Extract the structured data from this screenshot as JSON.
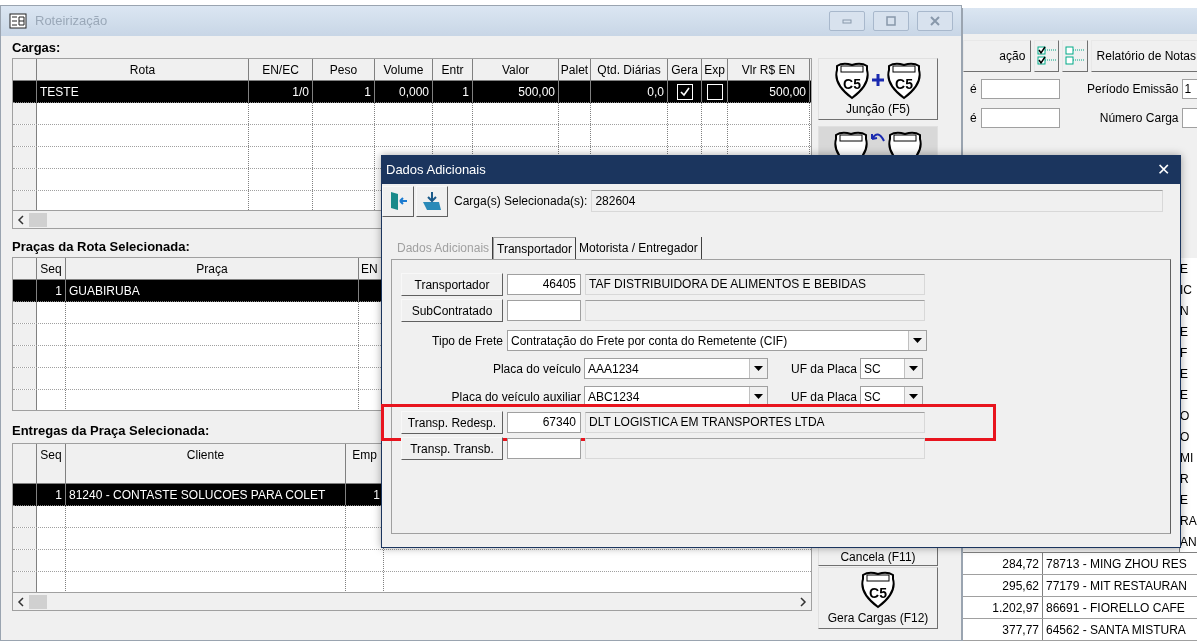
{
  "main_window": {
    "title": "Roteirização",
    "cargas": {
      "label": "Cargas:",
      "columns": [
        {
          "label": "Rota"
        },
        {
          "label": "EN/EC"
        },
        {
          "label": "Peso"
        },
        {
          "label": "Volume"
        },
        {
          "label": "Entr"
        },
        {
          "label": "Valor"
        },
        {
          "label": "Palet"
        },
        {
          "label": "Qtd. Diárias"
        },
        {
          "label": "Gera"
        },
        {
          "label": "Exp"
        },
        {
          "label": "Vlr R$ EN"
        }
      ],
      "rows": [
        {
          "selected": true,
          "cells": [
            "TESTE",
            "1/0",
            "1",
            "0,000",
            "1",
            "500,00",
            null,
            "0,0",
            {
              "kind": "checkbox",
              "checked": true
            },
            {
              "kind": "checkbox",
              "checked": false
            },
            "500,00"
          ]
        }
      ]
    },
    "pracas": {
      "label": "Praças da Rota Selecionada:",
      "columns": [
        {
          "label": "Seq"
        },
        {
          "label": "Praça"
        },
        {
          "label": "EN"
        }
      ],
      "rows": [
        {
          "selected": true,
          "cells": [
            "1",
            "GUABIRUBA",
            null
          ]
        }
      ]
    },
    "entregas": {
      "label": "Entregas da Praça Selecionada:",
      "columns": [
        {
          "label": "Seq"
        },
        {
          "label": "Cliente"
        },
        {
          "label": "Emp"
        }
      ],
      "rows": [
        {
          "selected": true,
          "cells": [
            "1",
            "81240 - CONTASTE SOLUCOES PARA COLET",
            "1"
          ]
        }
      ]
    },
    "side_buttons": [
      {
        "kind": "join",
        "label": "Junção (F5)",
        "shields": [
          "C5",
          "C5"
        ]
      },
      {
        "kind": "split"
      },
      {
        "kind": "cancel",
        "label": "Cancela (F11)"
      },
      {
        "kind": "generate",
        "label": "Gera Cargas (F12)",
        "shields": [
          "C5"
        ]
      }
    ]
  },
  "back_window": {
    "toolbar": [
      {
        "kind": "text",
        "label": "ação"
      },
      {
        "kind": "checkall"
      },
      {
        "kind": "uncheckall"
      },
      {
        "kind": "text",
        "label": "Relatório de Notas"
      }
    ],
    "fields": [
      {
        "left_label": "é",
        "right_label": "Período Emissão",
        "right_value": "1"
      },
      {
        "left_label": "é",
        "right_label": "Número Carga"
      }
    ],
    "right_edge_fragments": [
      "E",
      "IC",
      "N",
      "E",
      "F",
      "E",
      "E",
      "O",
      "O",
      "MI",
      "R",
      "E",
      "RA",
      "AN"
    ],
    "rows": [
      {
        "value": "284,72",
        "client": "78713 - MING ZHOU RES"
      },
      {
        "value": "295,62",
        "client": "77179 - MIT RESTAURAN"
      },
      {
        "value": "1.202,97",
        "client": "86691 - FIORELLO CAFE"
      },
      {
        "value": "377,77",
        "client": "64562 - SANTA MISTURA"
      }
    ]
  },
  "dialog": {
    "title": "Dados Adicionais",
    "close": "✕",
    "selected_label": "Carga(s) Selecionada(s):",
    "selected_value": "282604",
    "tabs": [
      {
        "label": "Dados Adicionais",
        "selected": false,
        "disabled": true
      },
      {
        "label": "Transportador",
        "selected": true,
        "disabled": false
      },
      {
        "label": "Motorista / Entregador",
        "selected": false,
        "disabled": false
      }
    ],
    "form": [
      {
        "kind": "lookup",
        "button": "Transportador",
        "code": "46405",
        "name": "TAF DISTRIBUIDORA DE ALIMENTOS E BEBIDAS",
        "highlighted": false
      },
      {
        "kind": "lookup",
        "button": "SubContratado",
        "highlighted": false
      },
      {
        "kind": "select",
        "label": "Tipo de Frete",
        "value": "Contratação do Frete por conta do Remetente (CIF)"
      },
      {
        "kind": "plate",
        "label": "Placa do veículo",
        "value": "AAA1234",
        "uf_label": "UF da Placa",
        "uf": "SC"
      },
      {
        "kind": "plate",
        "label": "Placa do veículo auxiliar",
        "value": "ABC1234",
        "uf_label": "UF da Placa",
        "uf": "SC"
      },
      {
        "kind": "lookup",
        "button": "Transp. Redesp.",
        "code": "67340",
        "name": "DLT LOGISTICA EM TRANSPORTES LTDA",
        "highlighted": true
      },
      {
        "kind": "lookup",
        "button": "Transp. Transb.",
        "highlighted": false
      }
    ]
  }
}
